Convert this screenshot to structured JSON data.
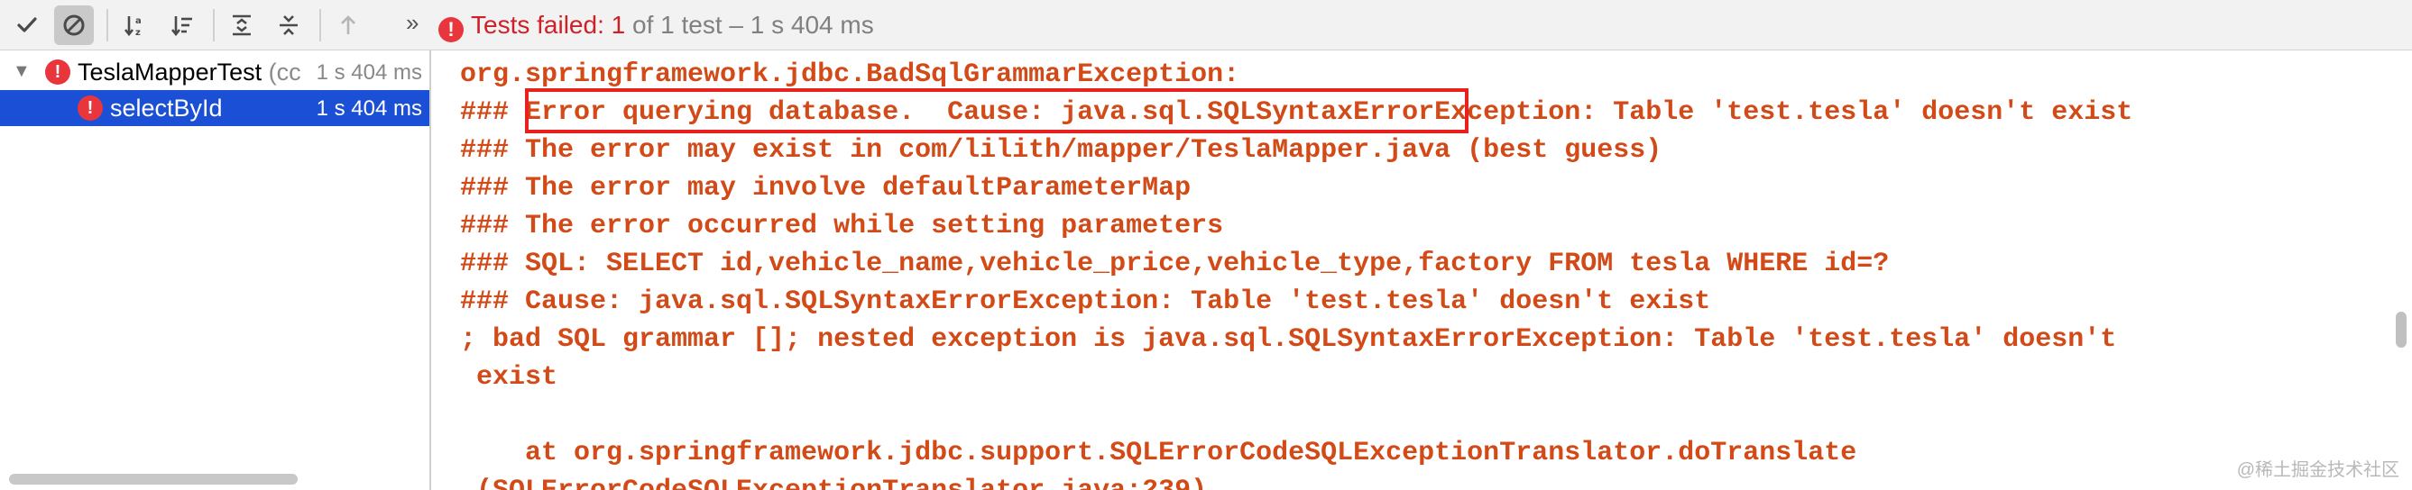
{
  "toolbar": {
    "status": {
      "label": "Tests failed:",
      "failed_count": "1",
      "rest": "of 1 test – 1 s 404 ms"
    },
    "more": "»"
  },
  "tree": {
    "items": [
      {
        "name": "TeslaMapperTest",
        "sub": "(cc",
        "time": "1 s 404 ms",
        "status": "failed",
        "expanded": true
      },
      {
        "name": "selectById",
        "time": "1 s 404 ms",
        "status": "failed",
        "selected": true
      }
    ]
  },
  "console": {
    "lines": [
      "org.springframework.jdbc.BadSqlGrammarException:",
      "### Error querying database.  Cause: java.sql.SQLSyntaxErrorException: Table 'test.tesla' doesn't exist",
      "### The error may exist in com/lilith/mapper/TeslaMapper.java (best guess)",
      "### The error may involve defaultParameterMap",
      "### The error occurred while setting parameters",
      "### SQL: SELECT id,vehicle_name,vehicle_price,vehicle_type,factory FROM tesla WHERE id=?",
      "### Cause: java.sql.SQLSyntaxErrorException: Table 'test.tesla' doesn't exist",
      "; bad SQL grammar []; nested exception is java.sql.SQLSyntaxErrorException: Table 'test.tesla' doesn't",
      " exist",
      "",
      "    at org.springframework.jdbc.support.SQLErrorCodeSQLExceptionTranslator.doTranslate",
      " (SQLErrorCodeSQLExceptionTranslator.java:239)"
    ]
  },
  "watermark": "@稀土掘金技术社区",
  "colors": {
    "error_red": "#e8363c",
    "console_text": "#d24a17",
    "selection": "#1a4fd6",
    "highlight_border": "#e8201e"
  }
}
